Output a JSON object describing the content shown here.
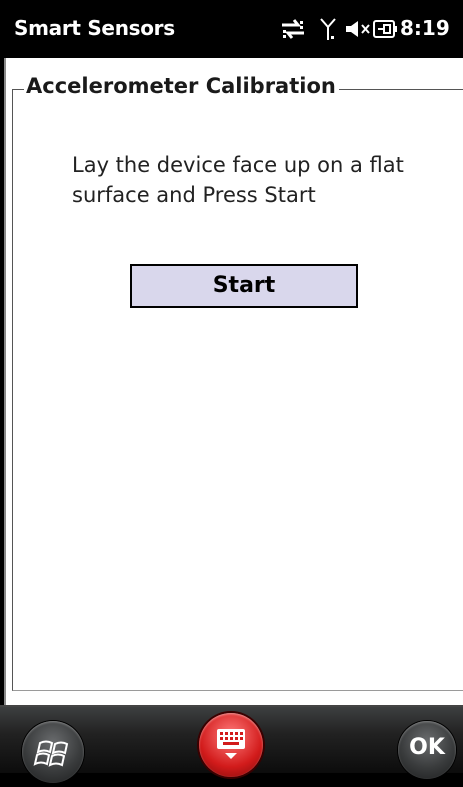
{
  "status_bar": {
    "app_title": "Smart Sensors",
    "time": "8:19"
  },
  "group": {
    "legend": "Accelerometer Calibration"
  },
  "instructions": "Lay the device face up on a flat surface and Press Start",
  "buttons": {
    "start_label": "Start"
  },
  "softkeys": {
    "ok_label": "OK"
  }
}
